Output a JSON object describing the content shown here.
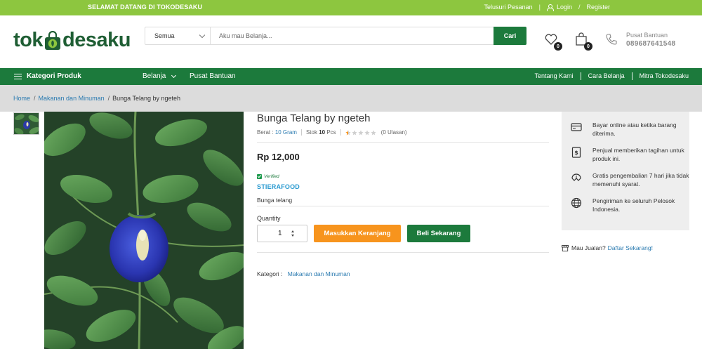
{
  "topbar": {
    "welcome": "SELAMAT DATANG DI TOKODESAKU",
    "track_orders": "Telusuri Pesanan",
    "login": "Login",
    "separator": "/",
    "register": "Register"
  },
  "header": {
    "logo_left": "tok",
    "logo_right": "desaku",
    "search": {
      "category": "Semua",
      "placeholder": "Aku mau Belanja...",
      "button": "Cari"
    },
    "wishlist_count": "0",
    "cart_count": "0",
    "help_label": "Pusat Bantuan",
    "help_phone": "089687641548"
  },
  "nav": {
    "categories": "Kategori Produk",
    "shop": "Belanja",
    "help_center": "Pusat Bantuan",
    "right_links": [
      "Tentang Kami",
      "Cara Belanja",
      "Mitra Tokodesaku"
    ]
  },
  "breadcrumb": {
    "home": "Home",
    "category": "Makanan dan Minuman",
    "current": "Bunga Telang by ngeteh",
    "separator": "/"
  },
  "product": {
    "title": "Bunga Telang by ngeteh",
    "weight_label": "Berat :",
    "weight_value": "10 Gram",
    "stock_label": "Stok",
    "stock_value": "10",
    "stock_unit": "Pcs",
    "rating": 0.5,
    "rating_max": 5,
    "reviews": "(0 Ulasan)",
    "price": "Rp 12,000",
    "verified": "Verified",
    "seller": "STIERAFOOD",
    "description": "Bunga telang",
    "quantity_label": "Quantity",
    "quantity": "1",
    "add_to_cart": "Masukkan Keranjang",
    "buy_now": "Beli Sekarang",
    "category_label": "Kategori :",
    "category_value": "Makanan dan Minuman"
  },
  "features": [
    {
      "icon": "payment-card-icon",
      "text": "Bayar online atau ketika barang diterima."
    },
    {
      "icon": "invoice-icon",
      "text": "Penjual memberikan tagihan untuk produk ini."
    },
    {
      "icon": "return-box-icon",
      "text": "Gratis pengembalian 7 hari jika tidak memenuhi syarat."
    },
    {
      "icon": "globe-icon",
      "text": "Pengiriman ke seluruh Pelosok Indonesia."
    }
  ],
  "sell_note": {
    "text": "Mau Jualan?",
    "link": "Daftar Sekarang!"
  },
  "colors": {
    "topbar": "#8dc63f",
    "primary_green": "#1c7a3c",
    "orange": "#f7941d",
    "link_blue": "#2a7ab0",
    "breadcrumb_bg": "#dcdcdc"
  }
}
